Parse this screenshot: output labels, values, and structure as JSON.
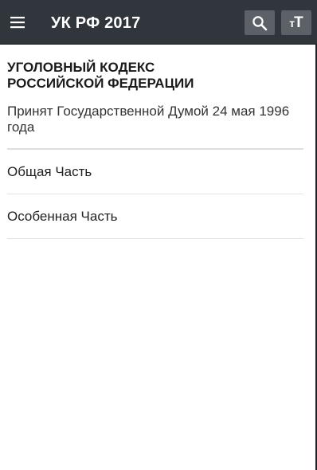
{
  "app_bar": {
    "title": "УК РФ 2017",
    "menu_icon": "hamburger-menu-icon",
    "actions": [
      {
        "icon": "search-icon"
      },
      {
        "icon": "text-size-icon",
        "label": "тТ"
      }
    ],
    "colors": {
      "background": "#30363b",
      "button": "#5b6166",
      "text": "#ffffff"
    }
  },
  "document": {
    "title_line1": "УГОЛОВНЫЙ КОДЕКС",
    "title_line2": "РОССИЙСКОЙ ФЕДЕРАЦИИ",
    "subtitle": "Принят Государственной Думой 24 мая 1996 года"
  },
  "sections": [
    {
      "label": "Общая Часть"
    },
    {
      "label": "Особенная Часть"
    }
  ]
}
